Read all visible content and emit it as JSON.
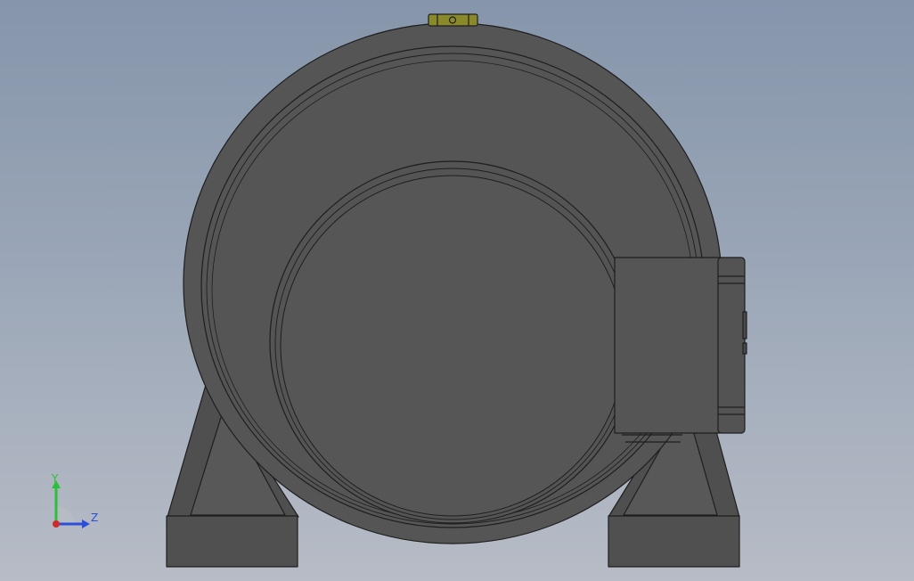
{
  "viewport": {
    "background_top": "#8695ab",
    "background_bottom": "#b7bcc6"
  },
  "model": {
    "body_color": "#555555",
    "edge_color": "#1e1e1e",
    "top_fitting_color": "#8a8a2a"
  },
  "triad": {
    "y_label": "Y",
    "z_label": "Z",
    "y_color": "#2bbf3a",
    "z_color": "#2b4fd8",
    "x_color": "#d02a2a"
  }
}
